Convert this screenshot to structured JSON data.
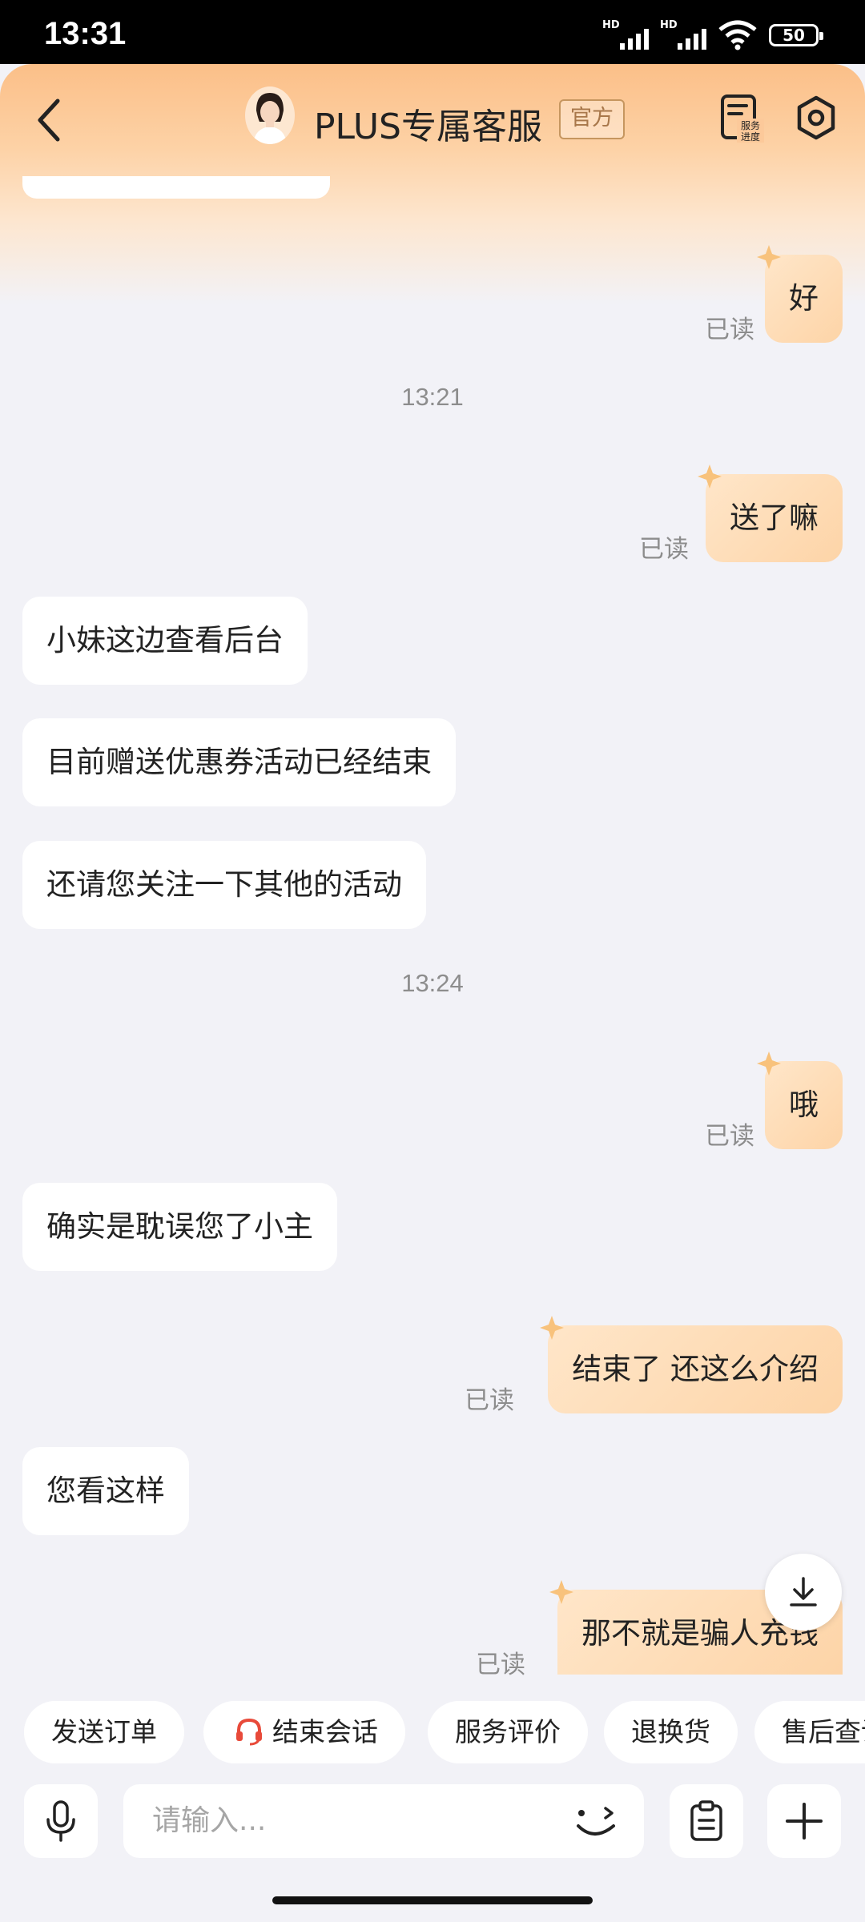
{
  "status_bar": {
    "time": "13:31",
    "network_1": "HD",
    "network_2": "HD",
    "battery": "50"
  },
  "header": {
    "title": "PLUS专属客服",
    "badge": "官方",
    "service_progress_label": "服务进度"
  },
  "messages": [
    {
      "side": "right",
      "text": "好",
      "status": "已读"
    },
    {
      "type": "timestamp",
      "text": "13:21"
    },
    {
      "side": "right",
      "text": "送了嘛",
      "status": "已读"
    },
    {
      "side": "left",
      "text": "小妹这边查看后台"
    },
    {
      "side": "left",
      "text": "目前赠送优惠券活动已经结束"
    },
    {
      "side": "left",
      "text": "还请您关注一下其他的活动"
    },
    {
      "type": "timestamp",
      "text": "13:24"
    },
    {
      "side": "right",
      "text": "哦",
      "status": "已读"
    },
    {
      "side": "left",
      "text": "确实是耽误您了小主"
    },
    {
      "side": "right",
      "text": "结束了 还这么介绍",
      "status": "已读"
    },
    {
      "side": "left",
      "text": "您看这样"
    },
    {
      "side": "right",
      "text": "那不就是骗人充钱",
      "status": "已读"
    }
  ],
  "quick_actions": [
    "发送订单",
    "结束会话",
    "服务评价",
    "退换货",
    "售后查询"
  ],
  "input": {
    "placeholder": "请输入..."
  },
  "icons": [
    "back-icon",
    "avatar",
    "service-progress-icon",
    "settings-icon",
    "star-icon",
    "scroll-down-icon",
    "headset-icon",
    "mic-icon",
    "emoji-icon",
    "clipboard-icon",
    "plus-icon"
  ],
  "colors": {
    "accent_orange": "#fbbf88",
    "bubble_self": "#fdd4a7",
    "headset_red": "#e84a3a",
    "page_bg": "#f2f2f7"
  }
}
